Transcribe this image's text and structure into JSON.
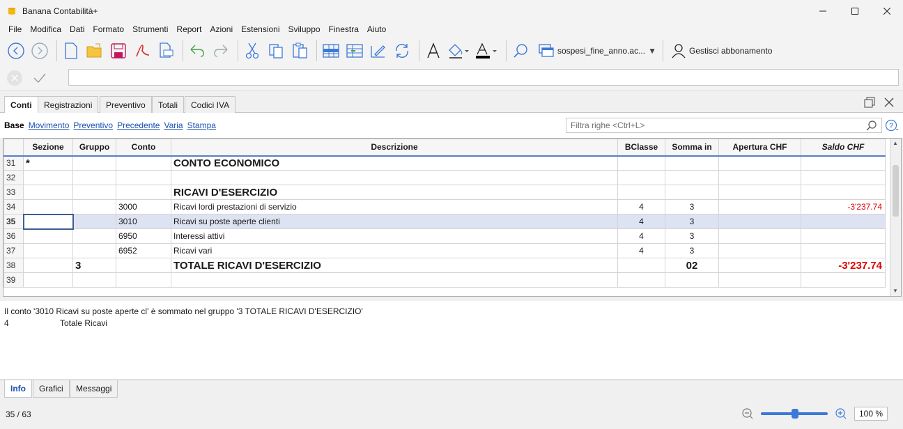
{
  "window": {
    "title": "Banana Contabilità+"
  },
  "menu": [
    "File",
    "Modifica",
    "Dati",
    "Formato",
    "Strumenti",
    "Report",
    "Azioni",
    "Estensioni",
    "Sviluppo",
    "Finestra",
    "Aiuto"
  ],
  "toolbar": {
    "file_name": "sospesi_fine_anno.ac...",
    "subscription_label": "Gestisci abbonamento"
  },
  "tabs_top": [
    "Conti",
    "Registrazioni",
    "Preventivo",
    "Totali",
    "Codici IVA"
  ],
  "views": [
    "Base",
    "Movimento",
    "Preventivo",
    "Precedente",
    "Varia",
    "Stampa"
  ],
  "filter": {
    "placeholder": "Filtra righe <Ctrl+L>"
  },
  "grid": {
    "headers": [
      "Sezione",
      "Gruppo",
      "Conto",
      "Descrizione",
      "BClasse",
      "Somma in",
      "Apertura CHF",
      "Saldo CHF"
    ],
    "rows": [
      {
        "n": "31",
        "sezione": "*",
        "gruppo": "",
        "conto": "",
        "descrizione": "CONTO ECONOMICO",
        "bclasse": "",
        "somma": "",
        "apertura": "",
        "saldo": "",
        "big": true
      },
      {
        "n": "32",
        "sezione": "",
        "gruppo": "",
        "conto": "",
        "descrizione": "",
        "bclasse": "",
        "somma": "",
        "apertura": "",
        "saldo": ""
      },
      {
        "n": "33",
        "sezione": "",
        "gruppo": "",
        "conto": "",
        "descrizione": "RICAVI D'ESERCIZIO",
        "bclasse": "",
        "somma": "",
        "apertura": "",
        "saldo": "",
        "big": true
      },
      {
        "n": "34",
        "sezione": "",
        "gruppo": "",
        "conto": "3000",
        "descrizione": "Ricavi lordi prestazioni di servizio",
        "bclasse": "4",
        "somma": "3",
        "apertura": "",
        "saldo": "-3'237.74"
      },
      {
        "n": "35",
        "sezione": "",
        "gruppo": "",
        "conto": "3010",
        "descrizione": "Ricavi su poste aperte clienti",
        "bclasse": "4",
        "somma": "3",
        "apertura": "",
        "saldo": "",
        "selected": true
      },
      {
        "n": "36",
        "sezione": "",
        "gruppo": "",
        "conto": "6950",
        "descrizione": "Interessi attivi",
        "bclasse": "4",
        "somma": "3",
        "apertura": "",
        "saldo": ""
      },
      {
        "n": "37",
        "sezione": "",
        "gruppo": "",
        "conto": "6952",
        "descrizione": "Ricavi vari",
        "bclasse": "4",
        "somma": "3",
        "apertura": "",
        "saldo": ""
      },
      {
        "n": "38",
        "sezione": "",
        "gruppo": "3",
        "conto": "",
        "descrizione": "TOTALE RICAVI D'ESERCIZIO",
        "bclasse": "",
        "somma": "02",
        "apertura": "",
        "saldo": "-3'237.74",
        "big": true
      },
      {
        "n": "39",
        "sezione": "",
        "gruppo": "",
        "conto": "",
        "descrizione": "",
        "bclasse": "",
        "somma": "",
        "apertura": "",
        "saldo": ""
      }
    ]
  },
  "info": {
    "line1": "Il conto '3010 Ricavi su poste aperte cl' è sommato nel gruppo '3 TOTALE RICAVI D'ESERCIZIO'",
    "line2_num": "4",
    "line2_text": "Totale Ricavi"
  },
  "tabs_bottom": [
    "Info",
    "Grafici",
    "Messaggi"
  ],
  "status": {
    "position": "35 / 63",
    "zoom": "100 %"
  },
  "colors": {
    "accent": "#3c78d8",
    "negative": "#e00000",
    "link": "#1a4fb3",
    "selected_row": "#dde3f2"
  }
}
